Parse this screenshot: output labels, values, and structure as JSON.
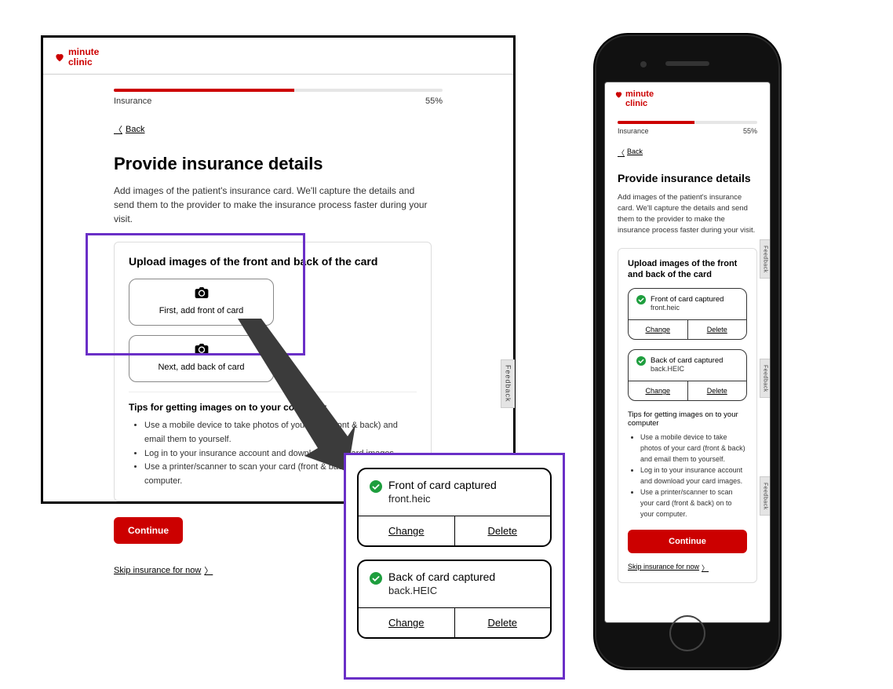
{
  "brand": {
    "line1": "minute",
    "line2": "clinic"
  },
  "progress": {
    "stage_label": "Insurance",
    "pct_label": "55%",
    "pct": 55
  },
  "nav": {
    "back": "Back"
  },
  "page": {
    "title": "Provide insurance details",
    "intro": "Add images of the patient's insurance card. We'll capture the details and send them to the provider to make the insurance process faster during your visit."
  },
  "upload": {
    "section_title": "Upload images of the front and back of the card",
    "front_btn": "First, add front of card",
    "back_btn": "Next, add back of card"
  },
  "tips": {
    "title": "Tips for getting images on to your computer",
    "items": [
      "Use a mobile device to take photos of your card (front & back) and email them to yourself.",
      "Log in to your insurance account and download your card images.",
      "Use a printer/scanner to scan your card (front & back) on to your computer."
    ]
  },
  "actions": {
    "continue": "Continue",
    "skip": "Skip insurance for now",
    "feedback": "Feedback"
  },
  "captured": {
    "front": {
      "title": "Front of card captured",
      "file": "front.heic"
    },
    "back": {
      "title": "Back of card captured",
      "file": "back.HEIC"
    },
    "change": "Change",
    "delete": "Delete"
  }
}
